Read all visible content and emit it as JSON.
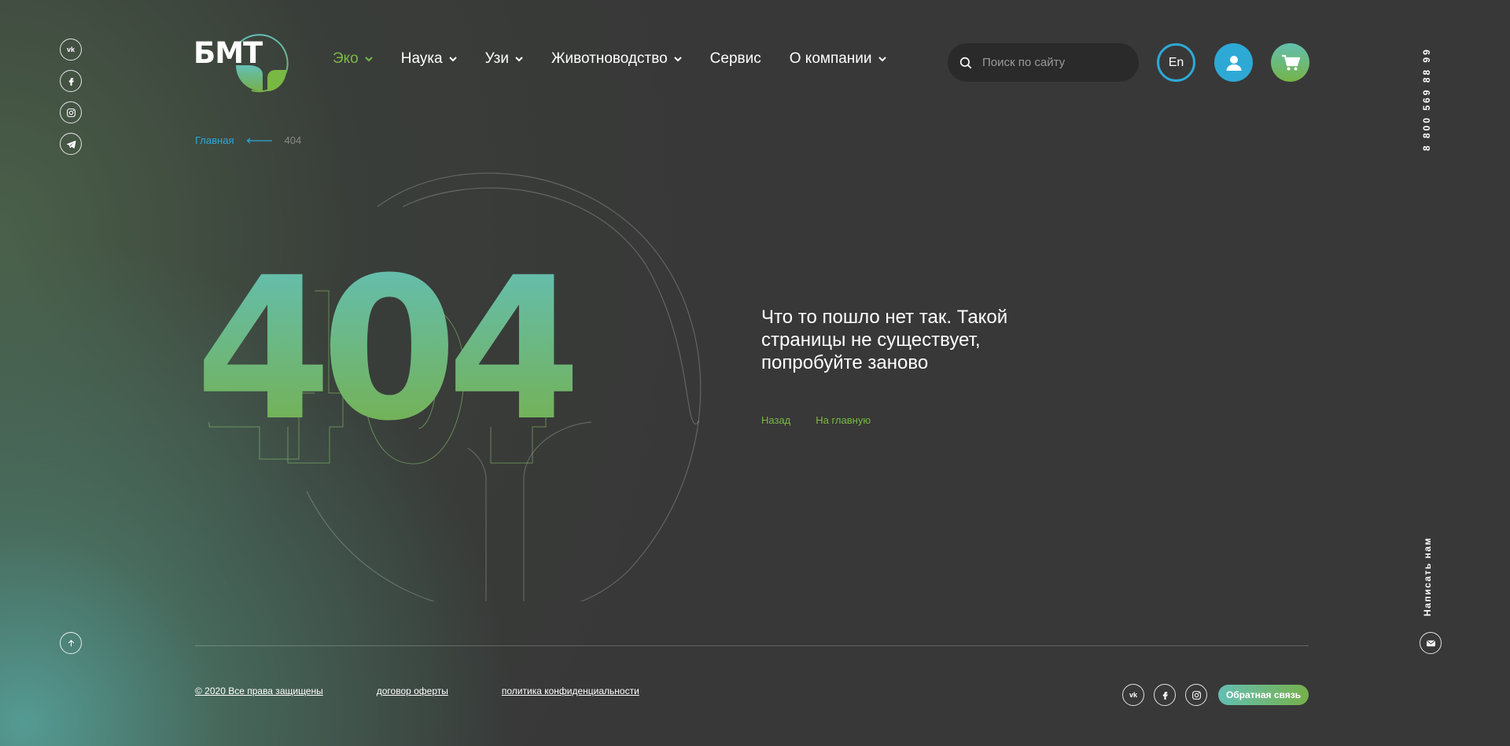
{
  "brand": {
    "logo_text": "БМТ"
  },
  "nav": {
    "items": [
      {
        "label": "Эко",
        "has_dropdown": true,
        "active": true
      },
      {
        "label": "Наука",
        "has_dropdown": true,
        "active": false
      },
      {
        "label": "Узи",
        "has_dropdown": true,
        "active": false
      },
      {
        "label": "Животноводство",
        "has_dropdown": true,
        "active": false
      },
      {
        "label": "Сервис",
        "has_dropdown": false,
        "active": false
      },
      {
        "label": "О компании",
        "has_dropdown": true,
        "active": false
      }
    ]
  },
  "search": {
    "placeholder": "Поиск по сайту",
    "value": "",
    "icon": "search-icon"
  },
  "header_buttons": {
    "lang_label": "En",
    "user_icon": "user-icon",
    "cart_icon": "cart-icon"
  },
  "side": {
    "phone": "8 800 569 88 99",
    "write_us": "Написать нам"
  },
  "social": [
    "vk-icon",
    "facebook-icon",
    "instagram-icon",
    "telegram-icon"
  ],
  "breadcrumb": {
    "home": "Главная",
    "current": "404"
  },
  "error": {
    "code": "404",
    "message": "Что то пошло нет так. Такой страницы не существует, попробуйте заново",
    "back_label": "Назад",
    "home_label": "На главную"
  },
  "footer": {
    "copyright": "© 2020 Все права защищены",
    "offer": "договор оферты",
    "privacy": "политика конфиденциальности",
    "feedback_label": "Обратная связь"
  },
  "colors": {
    "accent_green": "#7ab844",
    "accent_blue": "#2ea9d6",
    "teal": "#63bfb6",
    "background": "#383838"
  }
}
